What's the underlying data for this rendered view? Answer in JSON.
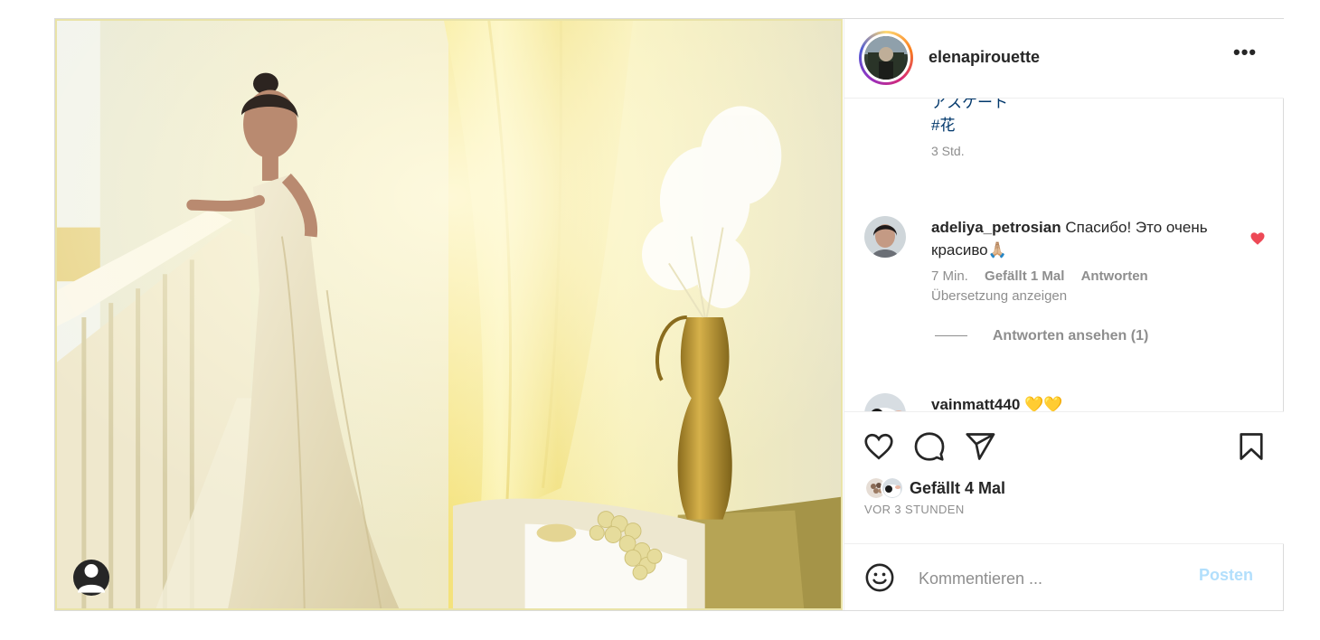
{
  "post": {
    "username": "elenapirouette",
    "more_label": "•••",
    "caption_tail": [
      "アスケート",
      "#花"
    ],
    "caption_time": "3 Std."
  },
  "comments": [
    {
      "username": "adeliya_petrosian",
      "text": "Спасибо! Это очень красиво🙏🏼",
      "time": "7 Min.",
      "likes": "Gefällt 1 Mal",
      "reply": "Antworten",
      "translate": "Übersetzung anzeigen",
      "liked": true,
      "view_replies": "Antworten ansehen (1)"
    },
    {
      "username": "vainmatt440",
      "text": "💛💛",
      "liked": false
    }
  ],
  "actions": {
    "likes_label": "Gefällt 4 Mal",
    "time_ago": "VOR 3 STUNDEN"
  },
  "composer": {
    "placeholder": "Kommentieren ...",
    "post_label": "Posten"
  },
  "icons": {
    "like": "heart-outline-icon",
    "comment": "speech-bubble-icon",
    "share": "paper-plane-icon",
    "save": "bookmark-icon",
    "emoji": "smiley-icon",
    "tag": "user-tag-icon",
    "more": "ellipsis-icon"
  },
  "colors": {
    "liked_heart": "#ed4956",
    "link_blue": "#00376b",
    "post_button_disabled": "#b2dffc",
    "muted": "#8e8e8e"
  }
}
